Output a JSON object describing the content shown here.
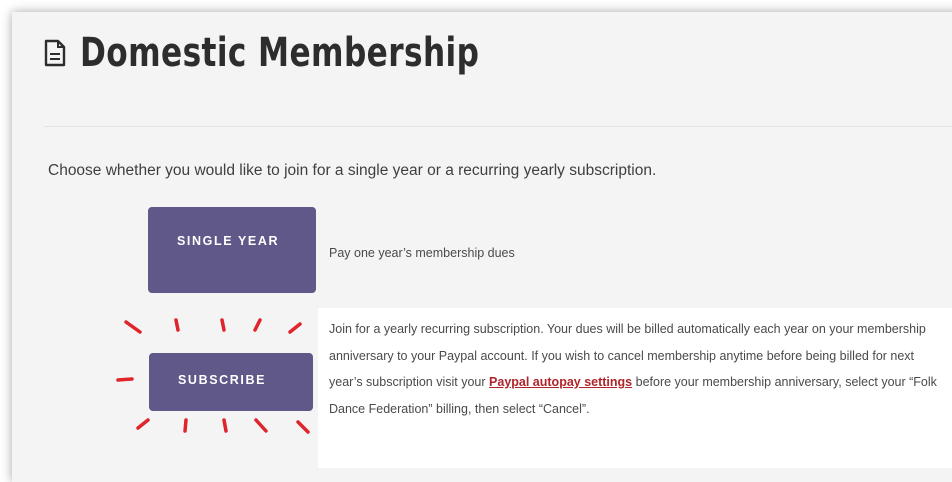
{
  "header": {
    "icon": "document-icon",
    "title": "Domestic Membership"
  },
  "intro": "Choose whether you would like to join for a single year or a recurring yearly subscription.",
  "options": [
    {
      "button_label": "SINGLE YEAR",
      "description": "Pay one year’s membership dues"
    },
    {
      "button_label": "SUBSCRIBE",
      "description_before": "Join for a yearly recurring subscription. Your dues will be billed automatically each year on your membership anniversary to your Paypal account. If you wish to cancel membership anytime before being billed for next year’s subscription visit your ",
      "link_text": "Paypal autopay settings",
      "description_after": " before your membership anniversary, select your “Folk Dance Federation” billing, then select “Cancel”."
    }
  ],
  "colors": {
    "button": "#5f5888",
    "link": "#b0242a",
    "burst": "#e0242b"
  }
}
